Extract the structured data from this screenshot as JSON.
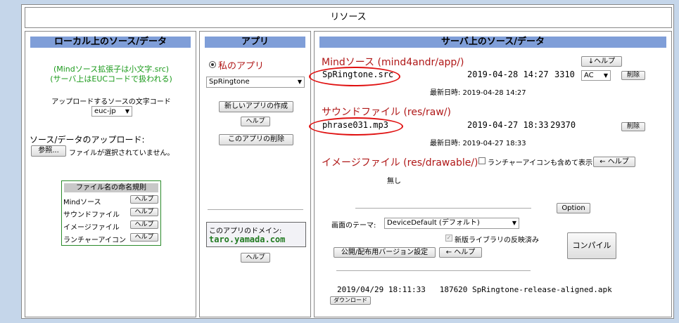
{
  "page_title": "リソース",
  "local": {
    "header": "ローカル上のソース/データ",
    "note_line1": "(Mindソース拡張子は小文字.src)",
    "note_line2": "(サーバ上はEUCコードで扱われる)",
    "encoding_label": "アップロードするソースの文字コード",
    "encoding_value": "euc-jp",
    "upload_label": "ソース/データのアップロード:",
    "browse_button": "参照...",
    "no_file_text": "ファイルが選択されていません。",
    "naming_title": "ファイル名の命名規則",
    "naming_rows": [
      {
        "label": "Mindソース",
        "button": "ヘルプ"
      },
      {
        "label": "サウンドファイル",
        "button": "ヘルプ"
      },
      {
        "label": "イメージファイル",
        "button": "ヘルプ"
      },
      {
        "label": "ランチャーアイコン",
        "button": "ヘルプ"
      }
    ]
  },
  "app": {
    "header": "アプリ",
    "my_app_label": "私のアプリ",
    "selected_app": "SpRingtone",
    "new_app_button": "新しいアプリの作成",
    "help_button": "ヘルプ",
    "delete_app_button": "このアプリの削除",
    "domain_label": "このアプリのドメイン:",
    "domain_value": "taro.yamada.com",
    "domain_help_button": "ヘルプ"
  },
  "server": {
    "header": "サーバ上のソース/データ",
    "help_top_button": "↓ヘルプ",
    "mind_heading": "Mindソース (mind4andr/app/)",
    "mind_file": {
      "name": "SpRingtone.src",
      "date": "2019-04-28 14:27",
      "size": "3310",
      "encoding": "AC",
      "delete": "削除",
      "latest": "最新日時: 2019-04-28 14:27"
    },
    "sound_heading": "サウンドファイル (res/raw/)",
    "sound_file": {
      "name": "phrase031.mp3",
      "date": "2019-04-27 18:33",
      "size": "29370",
      "delete": "削除",
      "latest": "最新日時: 2019-04-27 18:33"
    },
    "image_heading": "イメージファイル (res/drawable/)",
    "launcher_checkbox": "ランチャーアイコンも含めて表示",
    "image_help_button": "← ヘルプ",
    "image_none": "無し",
    "option_button": "Option",
    "theme_label": "画面のテーマ:",
    "theme_value": "DeviceDefault (デフォルト)",
    "newlib_checkbox": "新版ライブラリの反映済み",
    "publish_button": "公開/配布用バージョン設定",
    "publish_help_button": "← ヘルプ",
    "compile_button": "コンパイル",
    "apk_line": "2019/04/29 18:11:33   187620 SpRingtone-release-aligned.apk",
    "download_button": "ダウンロード"
  },
  "colors": {
    "panel_header": "#7f9ed8",
    "accent_red": "#b01818",
    "annotation_red": "#e01010",
    "page_bg": "#c5d6ea"
  }
}
